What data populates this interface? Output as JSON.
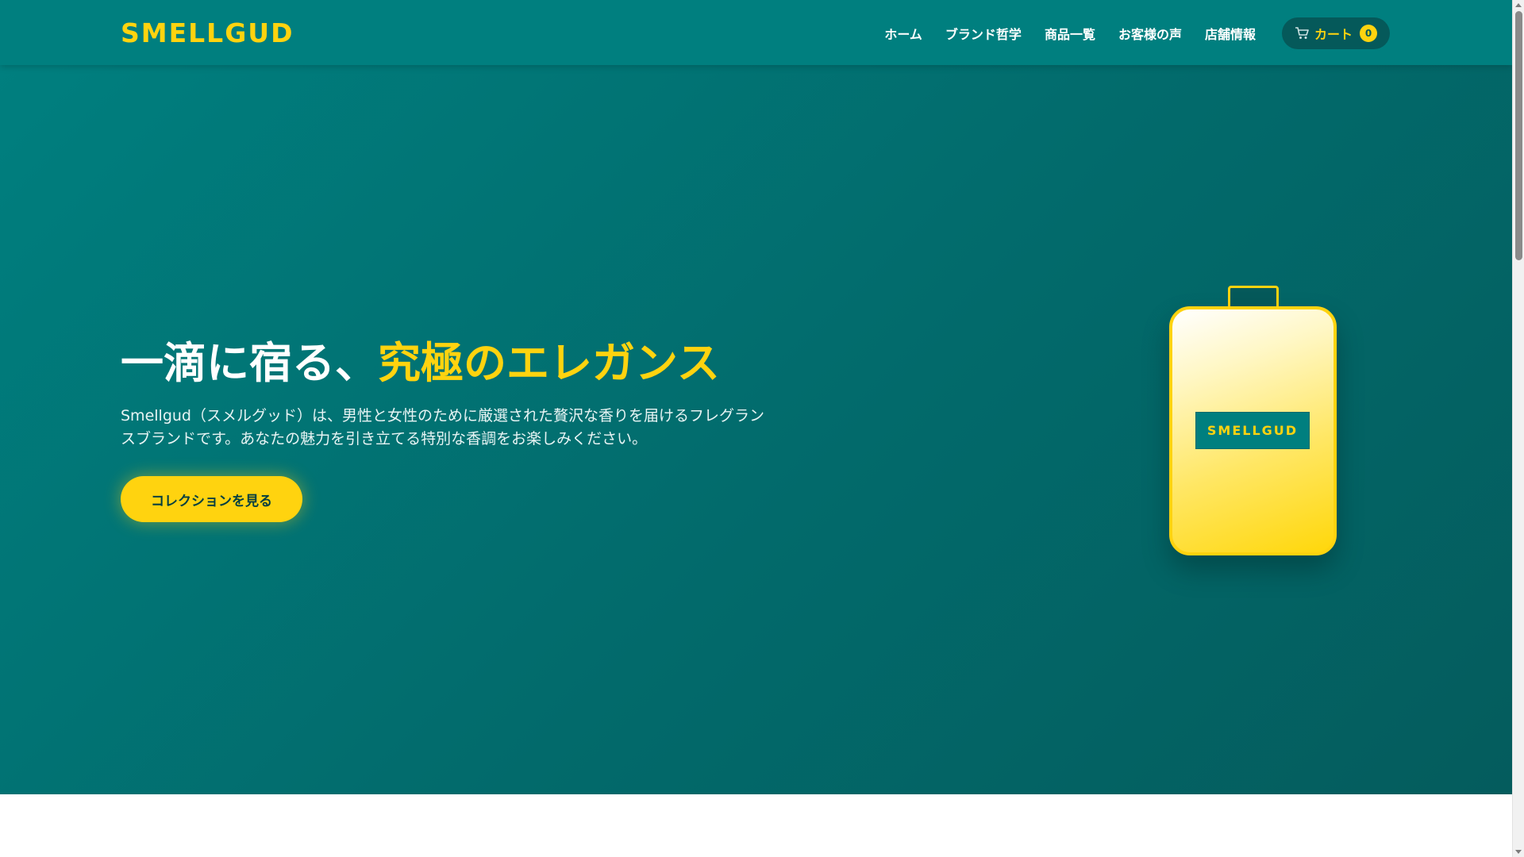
{
  "header": {
    "logo": "SMELLGUD",
    "nav": [
      {
        "label": "ホーム"
      },
      {
        "label": "ブランド哲学"
      },
      {
        "label": "商品一覧"
      },
      {
        "label": "お客様の声"
      },
      {
        "label": "店舗情報"
      }
    ],
    "cart": {
      "label": "カート",
      "count": "0",
      "icon": "cart-icon"
    }
  },
  "hero": {
    "title_main": "一滴に宿る、",
    "title_accent": "究極のエレガンス",
    "description": "Smellgud（スメルグッド）は、男性と女性のために厳選された贅沢な香りを届けるフレグランスブランドです。あなたの魅力を引き立てる特別な香調をお楽しみください。",
    "cta": "コレクションを見る",
    "bottle_label": "SMELLGUD"
  },
  "colors": {
    "brand_teal": "#007f7f",
    "accent_yellow": "#ffd30f"
  }
}
